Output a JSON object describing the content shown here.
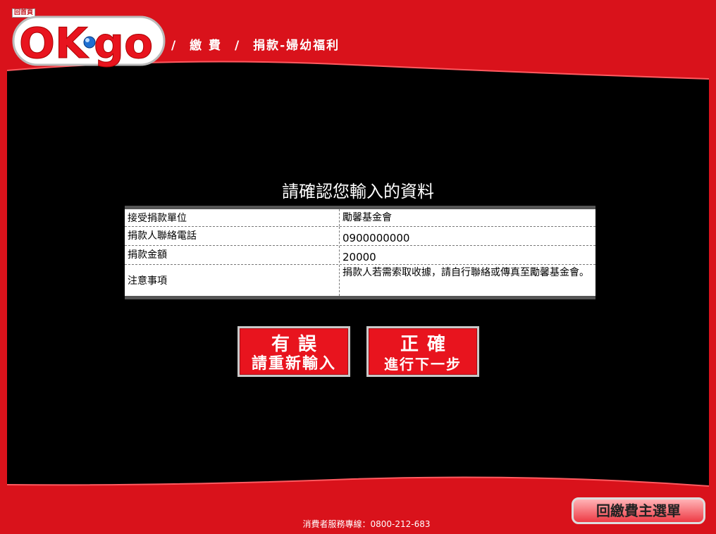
{
  "header": {
    "home_label": "回首頁",
    "logo_text": "OK·go",
    "breadcrumb": [
      "/",
      "繳 費",
      "/",
      "捐款-婦幼福利"
    ]
  },
  "main": {
    "title": "請確認您輸入的資料",
    "rows": [
      {
        "label": "接受捐款單位",
        "value": "勵馨基金會"
      },
      {
        "label": "捐款人聯絡電話",
        "value": "0900000000"
      },
      {
        "label": "捐款金額",
        "value": "20000"
      },
      {
        "label": "注意事項",
        "value": "捐款人若需索取收據，請自行聯絡或傳真至勵馨基金會。"
      }
    ],
    "wrong_button": {
      "line1": "有誤",
      "line2": "請重新輸入"
    },
    "correct_button": {
      "line1": "正確",
      "line2": "進行下一步"
    }
  },
  "footer": {
    "hotline": "消費者服務專線：0800-212-683",
    "menu_button": "回繳費主選單"
  },
  "colors": {
    "brand_red": "#e8141e",
    "panel": "#000000"
  }
}
